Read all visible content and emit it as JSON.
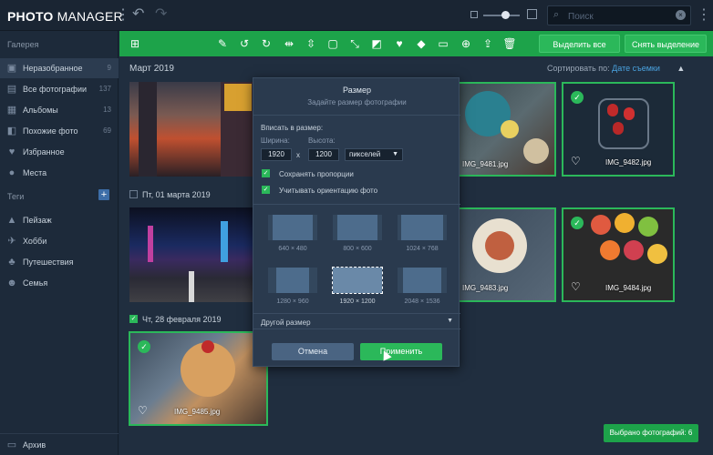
{
  "app": {
    "logo_bold": "PHOTO",
    "logo_rest": " MANAGER"
  },
  "search": {
    "placeholder": "Поиск"
  },
  "sidebar": {
    "gallery_heading": "Галерея",
    "items": [
      {
        "label": "Неразобранное",
        "count": "9",
        "icon": "inbox-icon"
      },
      {
        "label": "Все фотографии",
        "count": "137",
        "icon": "photos-icon"
      },
      {
        "label": "Альбомы",
        "count": "13",
        "icon": "album-icon"
      },
      {
        "label": "Похожие фото",
        "count": "69",
        "icon": "similar-icon"
      },
      {
        "label": "Избранное",
        "count": "",
        "icon": "heart-icon"
      },
      {
        "label": "Места",
        "count": "",
        "icon": "pin-icon"
      }
    ],
    "tags_heading": "Теги",
    "tags": [
      {
        "label": "Пейзаж",
        "icon": "landscape-icon"
      },
      {
        "label": "Хобби",
        "icon": "plane-icon"
      },
      {
        "label": "Путешествия",
        "icon": "travel-icon"
      },
      {
        "label": "Семья",
        "icon": "family-icon"
      }
    ],
    "archive": "Архив"
  },
  "toolbar": {
    "select_all": "Выделить все",
    "deselect": "Снять выделение"
  },
  "gallery": {
    "month": "Март 2019",
    "sort_label": "Сортировать по:",
    "sort_value": "Дате съемки",
    "date1": "Пт, 01 марта 2019",
    "date2": "Чт, 28 февраля 2019",
    "files": [
      "IMG_9481.jpg",
      "IMG_9482.jpg",
      "IMG_9483.jpg",
      "IMG_9484.jpg",
      "IMG_9485.jpg"
    ]
  },
  "modal": {
    "title": "Размер",
    "subtitle": "Задайте размер фотографии",
    "fit_label": "Вписать в размер:",
    "width_label": "Ширина:",
    "height_label": "Высота:",
    "width_value": "1920",
    "height_value": "1200",
    "x_sign": "x",
    "unit": "пикселей",
    "keep_ratio": "Сохранять пропорции",
    "orientation": "Учитывать ориентацию фото",
    "presets": [
      "640 × 480",
      "800 × 600",
      "1024 × 768",
      "1280 × 960",
      "1920 × 1200",
      "2048 × 1536"
    ],
    "other_size": "Другой размер",
    "cancel": "Отмена",
    "apply": "Применить"
  },
  "status": {
    "selected": "Выбрано фотографий: 6"
  },
  "colors": {
    "accent": "#2bb85a",
    "link": "#4aa3e0",
    "bg": "#202e3f"
  }
}
